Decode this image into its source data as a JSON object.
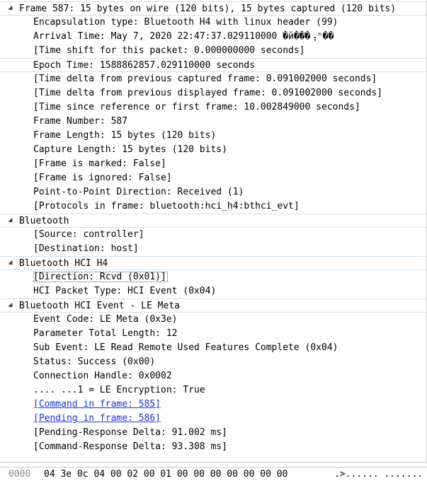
{
  "tree": [
    {
      "level": 0,
      "text": "Frame 587: 15 bytes on wire (120 bits), 15 bytes captured (120 bits)",
      "style": "border"
    },
    {
      "level": 1,
      "text": "Encapsulation type: Bluetooth H4 with linux header (99)"
    },
    {
      "level": 1,
      "text": "Arrival Time: May  7, 2020 22:47:37.029110000 �й���⢠ⁿ��"
    },
    {
      "level": 1,
      "text": "[Time shift for this packet: 0.000000000 seconds]"
    },
    {
      "level": 1,
      "text": "Epoch Time: 1588862857.029110000 seconds",
      "style": "border"
    },
    {
      "level": 1,
      "text": "[Time delta from previous captured frame: 0.091002000 seconds]"
    },
    {
      "level": 1,
      "text": "[Time delta from previous displayed frame: 0.091002000 seconds]"
    },
    {
      "level": 1,
      "text": "[Time since reference or first frame: 10.002849000 seconds]"
    },
    {
      "level": 1,
      "text": "Frame Number: 587"
    },
    {
      "level": 1,
      "text": "Frame Length: 15 bytes (120 bits)"
    },
    {
      "level": 1,
      "text": "Capture Length: 15 bytes (120 bits)"
    },
    {
      "level": 1,
      "text": "[Frame is marked: False]"
    },
    {
      "level": 1,
      "text": "[Frame is ignored: False]"
    },
    {
      "level": 1,
      "text": "Point-to-Point Direction: Received (1)"
    },
    {
      "level": 1,
      "text": "[Protocols in frame: bluetooth:hci_h4:bthci_evt]"
    },
    {
      "level": 0,
      "text": "Bluetooth",
      "style": "border"
    },
    {
      "level": 1,
      "text": "[Source: controller]"
    },
    {
      "level": 1,
      "text": "[Destination: host]"
    },
    {
      "level": 0,
      "text": "Bluetooth HCI H4",
      "style": "border"
    },
    {
      "level": 1,
      "text": "[Direction: Rcvd (0x01)]",
      "style": "dotted"
    },
    {
      "level": 1,
      "text": "HCI Packet Type: HCI Event (0x04)"
    },
    {
      "level": 0,
      "text": "Bluetooth HCI Event - LE Meta",
      "style": "border"
    },
    {
      "level": 1,
      "text": "Event Code: LE Meta (0x3e)"
    },
    {
      "level": 1,
      "text": "Parameter Total Length: 12"
    },
    {
      "level": 1,
      "text": "Sub Event: LE Read Remote Used Features Complete (0x04)"
    },
    {
      "level": 1,
      "text": "Status: Success (0x00)"
    },
    {
      "level": 1,
      "text": "Connection Handle: 0x0002"
    },
    {
      "level": 1,
      "text": ".... ...1 = LE Encryption: True"
    },
    {
      "level": 1,
      "text": "[Command in frame: 585]",
      "link": true
    },
    {
      "level": 1,
      "text": "[Pending in frame: 586]",
      "link": true
    },
    {
      "level": 1,
      "text": "[Pending-Response Delta: 91.002 ms]"
    },
    {
      "level": 1,
      "text": "[Command-Response Delta: 93.308 ms]"
    }
  ],
  "hex": {
    "offset": "0000",
    "bytes": "04 3e 0c 04 00 02 00 01  00 00 00 00 00 00 00",
    "ascii": ".>...... ......."
  },
  "colors": {
    "link": "#1a32d8",
    "selection_border": "#cfe0f0",
    "offset_text": "#8a8a8a"
  }
}
